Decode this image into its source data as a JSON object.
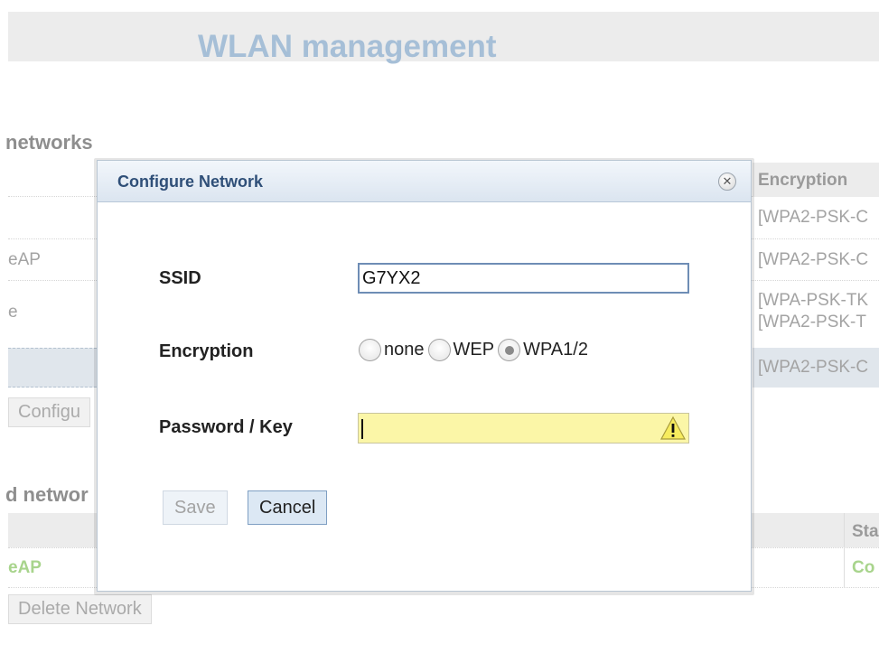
{
  "page": {
    "title": "WLAN management",
    "available_section_title": "networks",
    "encryption_header": "Encryption",
    "available_networks": [
      {
        "name": "",
        "encryption": "[WPA2-PSK-C"
      },
      {
        "name": "eAP",
        "encryption": "[WPA2-PSK-C"
      },
      {
        "name": "e",
        "encryption": "[WPA-PSK-TK",
        "encryption2": "[WPA2-PSK-T"
      },
      {
        "name": "",
        "encryption": "[WPA2-PSK-C"
      }
    ],
    "configure_button": "Configu",
    "configured_section_title": "d networ",
    "status_header": "Sta",
    "configured_networks": [
      {
        "name": "eAP",
        "status": "Co"
      }
    ],
    "delete_button": "Delete Network"
  },
  "dialog": {
    "title": "Configure Network",
    "close_icon": "close-circle-icon",
    "ssid_label": "SSID",
    "ssid_value": "G7YX2",
    "encryption_label": "Encryption",
    "encryption_options": [
      "none",
      "WEP",
      "WPA1/2"
    ],
    "encryption_selected": "WPA1/2",
    "password_label": "Password / Key",
    "password_value": "",
    "warning_icon": "warning-icon",
    "save_label": "Save",
    "cancel_label": "Cancel"
  },
  "colors": {
    "header_title": "#a6bfd7",
    "dialog_title": "#2f4f78",
    "password_field_bg": "#fbf6a7",
    "status_green": "#a8d48c"
  }
}
